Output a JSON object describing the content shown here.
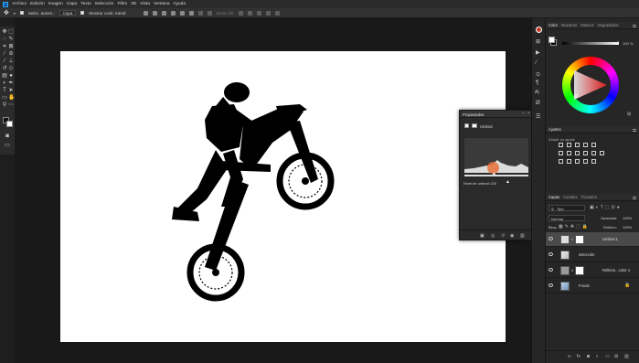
{
  "app": {
    "logo_text": "Ps",
    "menu": [
      "Archivo",
      "Edición",
      "Imagen",
      "Capa",
      "Texto",
      "Selección",
      "Filtro",
      "3D",
      "Vista",
      "Ventana",
      "Ayuda"
    ]
  },
  "options_bar": {
    "auto_select_label": "Selec. autom.:",
    "auto_select_value": "Capa",
    "transform_controls_label": "Mostrar contr. transf.",
    "mode_3d_label": "Modo 3D:"
  },
  "toolbar": {
    "icons": [
      "move-icon",
      "marquee-icon",
      "lasso-icon",
      "quick-select-icon",
      "crop-icon",
      "frame-icon",
      "eyedropper-icon",
      "healing-icon",
      "brush-icon",
      "stamp-icon",
      "history-brush-icon",
      "eraser-icon",
      "gradient-icon",
      "blur-icon",
      "dodge-icon",
      "pen-icon",
      "type-icon",
      "path-select-icon",
      "rectangle-icon",
      "hand-icon",
      "zoom-icon",
      "more-tools-icon"
    ]
  },
  "properties_panel": {
    "title": "Propiedades",
    "layer_type": "Umbral",
    "threshold_label": "Nivel de umbral:",
    "threshold_value": "128"
  },
  "color_panel": {
    "tabs": [
      "Color",
      "Muestras",
      "Motivos",
      "Degradados"
    ],
    "active_tab": "Color",
    "brightness_value": "100",
    "foreground": "#ffffff",
    "background": "#000000"
  },
  "adjustments_panel": {
    "title": "Ajustes",
    "add_label": "Añadir un ajuste"
  },
  "layers_panel": {
    "tabs": [
      "Capas",
      "Canales",
      "Trazados"
    ],
    "active_tab": "Capas",
    "filter_kind": "Tipo",
    "blend_mode": "Normal",
    "opacity_label": "Opacidad:",
    "opacity_value": "100%",
    "fill_label": "Relleno:",
    "fill_value": "100%",
    "lock_label": "Bloq.:",
    "layers": [
      {
        "name": "Umbral 1",
        "selected": true
      },
      {
        "name": "selección",
        "selected": false
      },
      {
        "name": "Relleno...color 1",
        "selected": false
      },
      {
        "name": "Fondo",
        "selected": false
      }
    ]
  },
  "colors": {
    "accent_blue": "#31a8ff",
    "cursor_highlight": "#e8713a"
  }
}
